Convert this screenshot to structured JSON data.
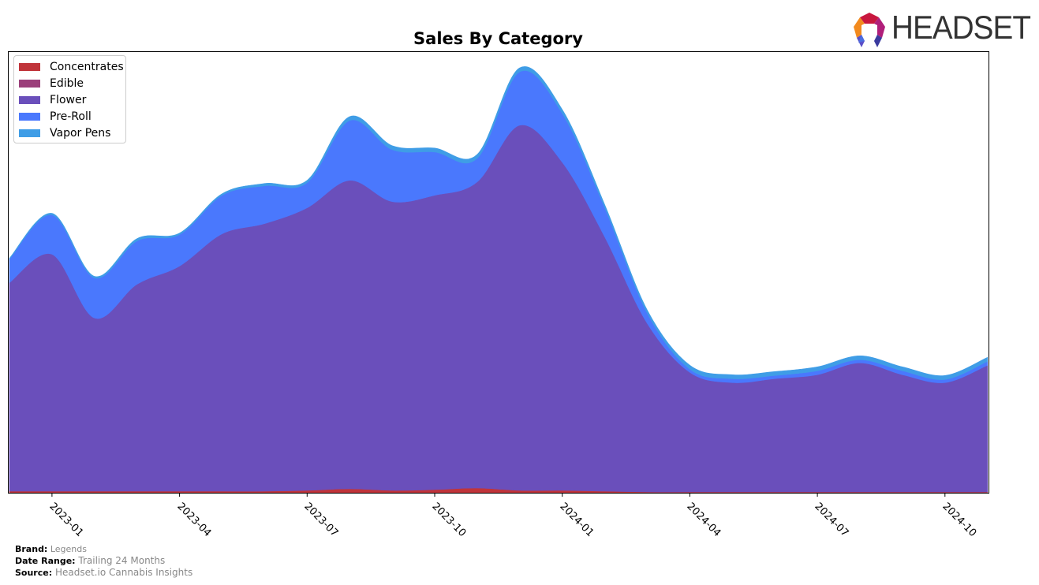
{
  "header": {
    "logo_text": "HEADSET"
  },
  "footer": {
    "brand_label": "Brand:",
    "brand_value": "Legends",
    "date_range_label": "Date Range:",
    "date_range_value": "Trailing 24 Months",
    "source_label": "Source:",
    "source_value": "Headset.io Cannabis Insights"
  },
  "chart_data": {
    "type": "area",
    "stacked": true,
    "title": "Sales By Category",
    "xlabel": "",
    "ylabel": "",
    "x": [
      "2022-12",
      "2023-01",
      "2023-02",
      "2023-03",
      "2023-04",
      "2023-05",
      "2023-06",
      "2023-07",
      "2023-08",
      "2023-09",
      "2023-10",
      "2023-11",
      "2023-12",
      "2024-01",
      "2024-02",
      "2024-03",
      "2024-04",
      "2024-05",
      "2024-06",
      "2024-07",
      "2024-08",
      "2024-09",
      "2024-10",
      "2024-11"
    ],
    "xticks": [
      "2023-01",
      "2023-04",
      "2023-07",
      "2023-10",
      "2024-01",
      "2024-04",
      "2024-07",
      "2024-10"
    ],
    "ylim": [
      0,
      560
    ],
    "yticks_visible": false,
    "grid": false,
    "legend_position": "top-left",
    "series": [
      {
        "name": "Concentrates",
        "color": "#c0343a",
        "values": [
          2,
          2,
          2,
          2,
          2,
          2,
          2,
          3,
          5,
          3,
          4,
          6,
          3,
          3,
          2,
          1,
          1,
          1,
          1,
          1,
          1,
          1,
          1,
          1
        ]
      },
      {
        "name": "Edible",
        "color": "#9b3f7a",
        "values": [
          0,
          0,
          0,
          0,
          0,
          0,
          0,
          0,
          0,
          0,
          0,
          0,
          0,
          0,
          0,
          0,
          0,
          0,
          0,
          0,
          0,
          0,
          0,
          0
        ]
      },
      {
        "name": "Flower",
        "color": "#6a4fbb",
        "values": [
          265,
          301,
          220,
          263,
          286,
          327,
          340,
          359,
          392,
          367,
          374,
          389,
          464,
          417,
          323,
          214,
          152,
          139,
          144,
          149,
          164,
          149,
          139,
          161
        ]
      },
      {
        "name": "Pre-Roll",
        "color": "#4a78fd",
        "values": [
          30,
          50,
          51,
          55,
          40,
          49,
          48,
          32,
          76,
          66,
          55,
          30,
          68,
          62,
          37,
          13,
          4,
          5,
          4,
          5,
          4,
          5,
          4,
          5
        ]
      },
      {
        "name": "Vapor Pens",
        "color": "#3f9de6",
        "values": [
          1,
          2,
          2,
          3,
          2,
          2,
          3,
          3,
          5,
          5,
          5,
          5,
          5,
          5,
          4,
          4,
          5,
          5,
          5,
          5,
          5,
          5,
          5,
          5
        ]
      }
    ]
  }
}
